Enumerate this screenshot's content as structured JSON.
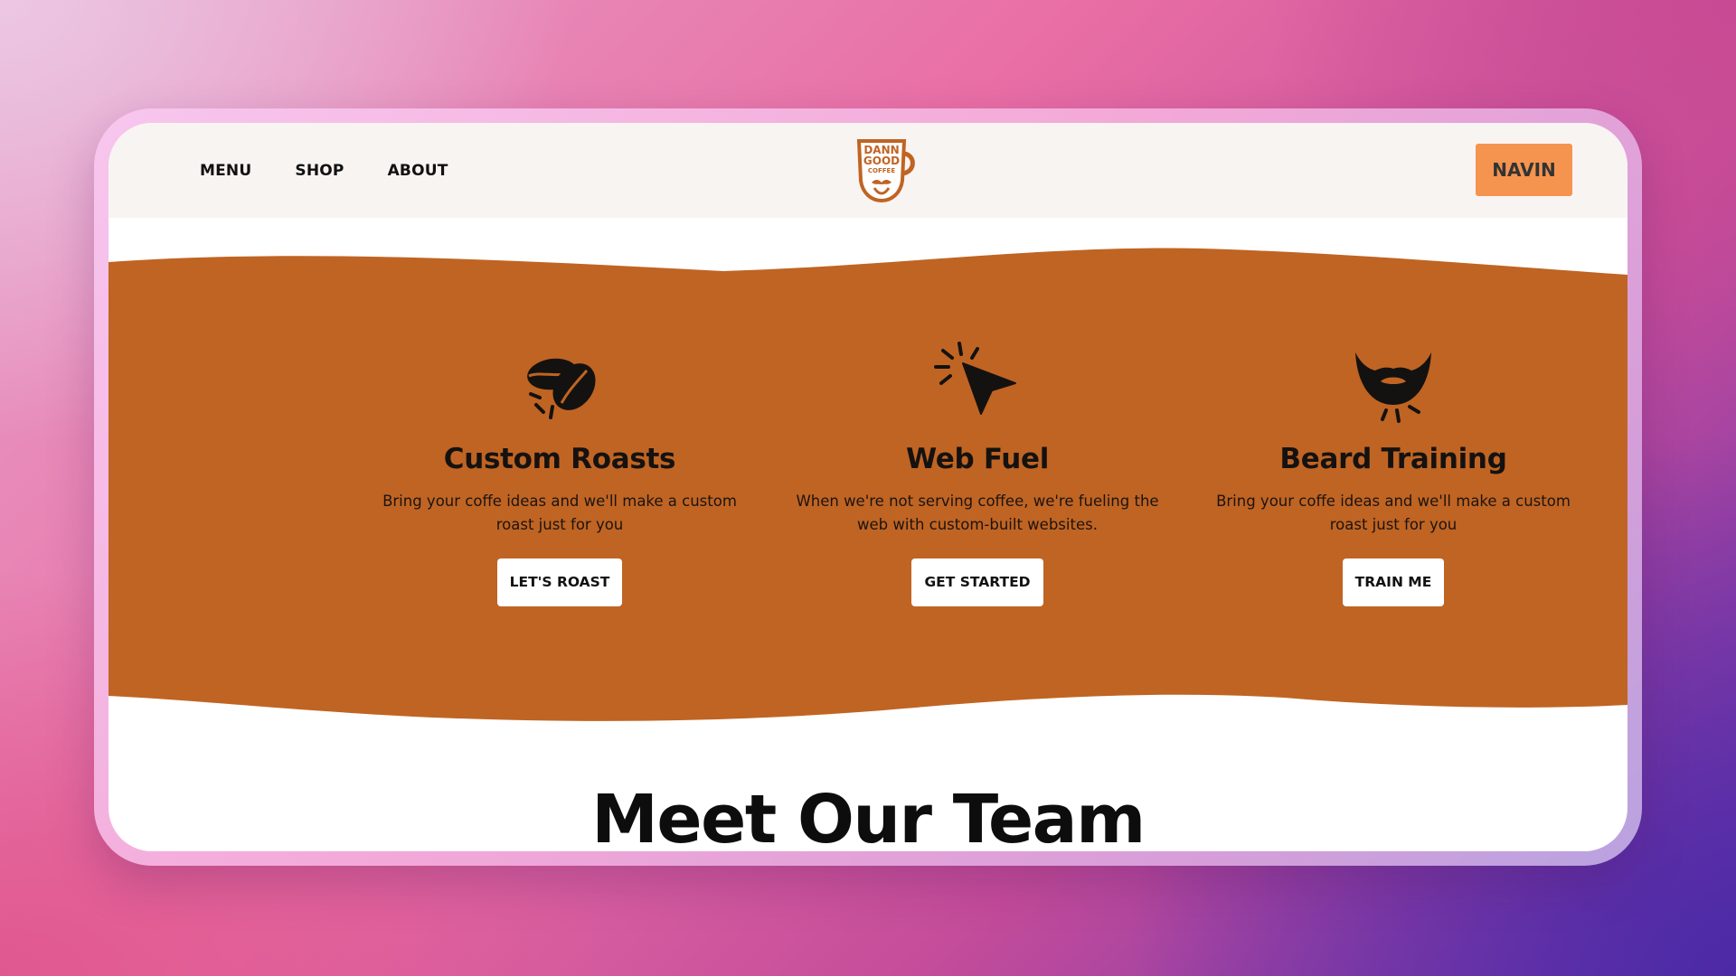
{
  "nav": {
    "links": [
      "MENU",
      "SHOP",
      "ABOUT"
    ],
    "logo": {
      "name": "dann-good-coffee-logo",
      "lines": [
        "DANN",
        "GOOD",
        "COFFEE"
      ]
    },
    "user_button": "NAVIN"
  },
  "features": [
    {
      "icon": "coffee-beans-icon",
      "title": "Custom Roasts",
      "description": "Bring your coffe ideas and we'll make a custom roast just for you",
      "button": "LET'S ROAST"
    },
    {
      "icon": "cursor-click-icon",
      "title": "Web Fuel",
      "description": "When we're not serving coffee, we're fueling the web with custom-built websites.",
      "button": "GET STARTED"
    },
    {
      "icon": "beard-icon",
      "title": "Beard Training",
      "description": "Bring your coffe ideas and we'll make a custom roast just for you",
      "button": "TRAIN ME"
    }
  ],
  "team": {
    "heading": "Meet Our Team"
  },
  "colors": {
    "brand_orange": "#c06423",
    "accent_button": "#f5944f",
    "nav_bg": "#f8f4f2",
    "ink": "#141210"
  }
}
